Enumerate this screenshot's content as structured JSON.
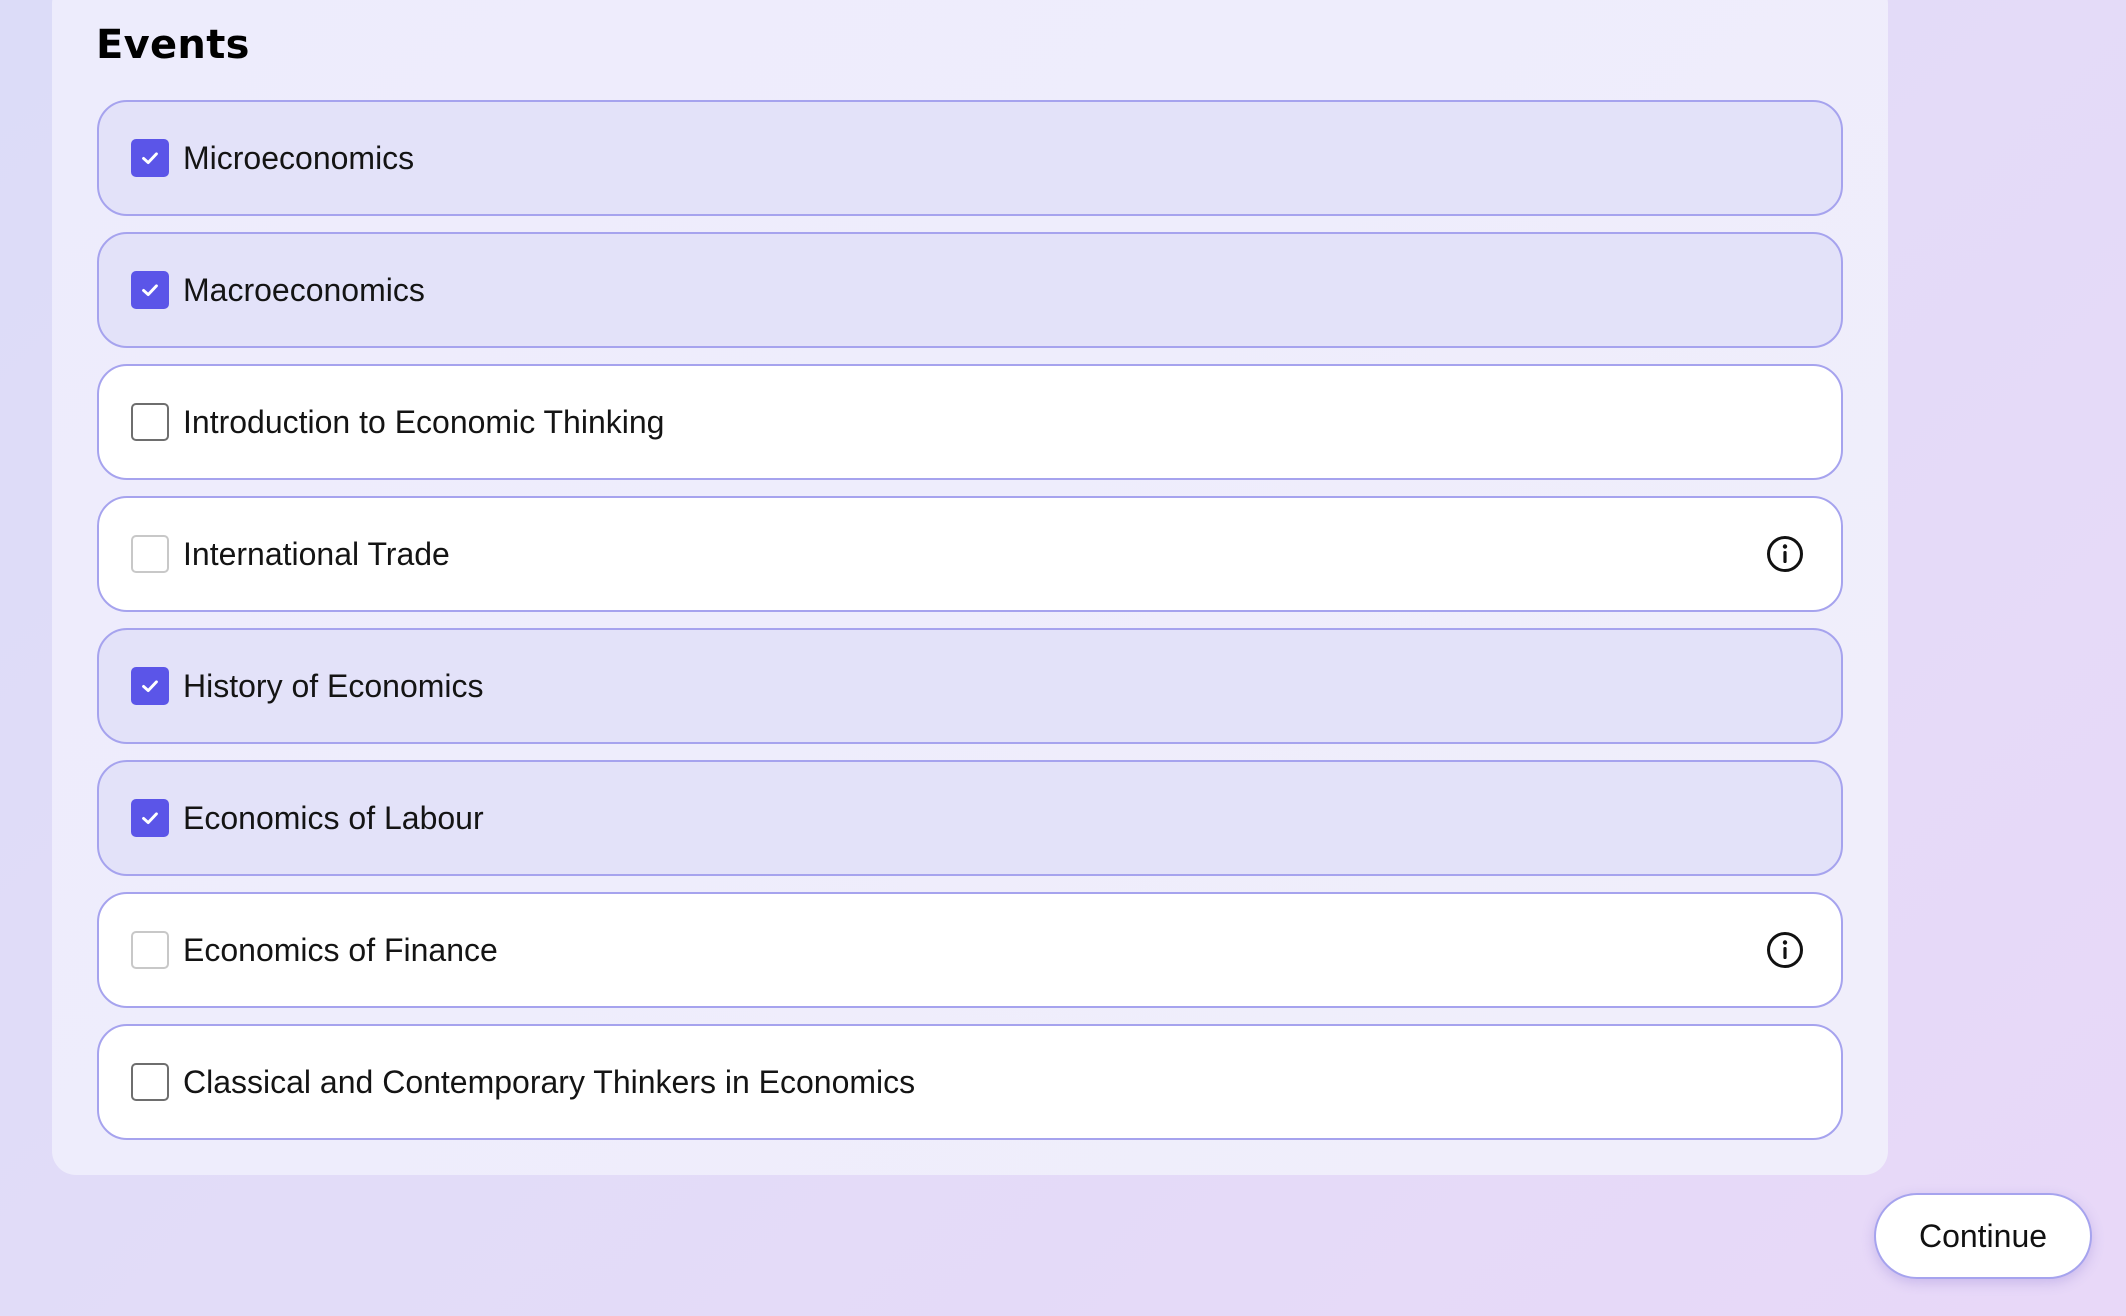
{
  "section": {
    "title": "Events"
  },
  "events": [
    {
      "label": "Microeconomics",
      "checked": true,
      "info": false
    },
    {
      "label": "Macroeconomics",
      "checked": true,
      "info": false
    },
    {
      "label": "Introduction to Economic Thinking",
      "checked": false,
      "info": false
    },
    {
      "label": "International Trade",
      "checked": false,
      "info": true
    },
    {
      "label": "History of Economics",
      "checked": true,
      "info": false
    },
    {
      "label": "Economics of Labour",
      "checked": true,
      "info": false
    },
    {
      "label": "Economics of Finance",
      "checked": false,
      "info": true
    },
    {
      "label": "Classical and Contemporary Thinkers in Economics",
      "checked": false,
      "info": false
    }
  ],
  "actions": {
    "continue_label": "Continue"
  },
  "colors": {
    "accent": "#5b55e8",
    "checked_row_bg": "#e3e2f9",
    "row_border": "#a6a3ee"
  },
  "icons": {
    "check": "check-icon",
    "info": "info-icon"
  }
}
